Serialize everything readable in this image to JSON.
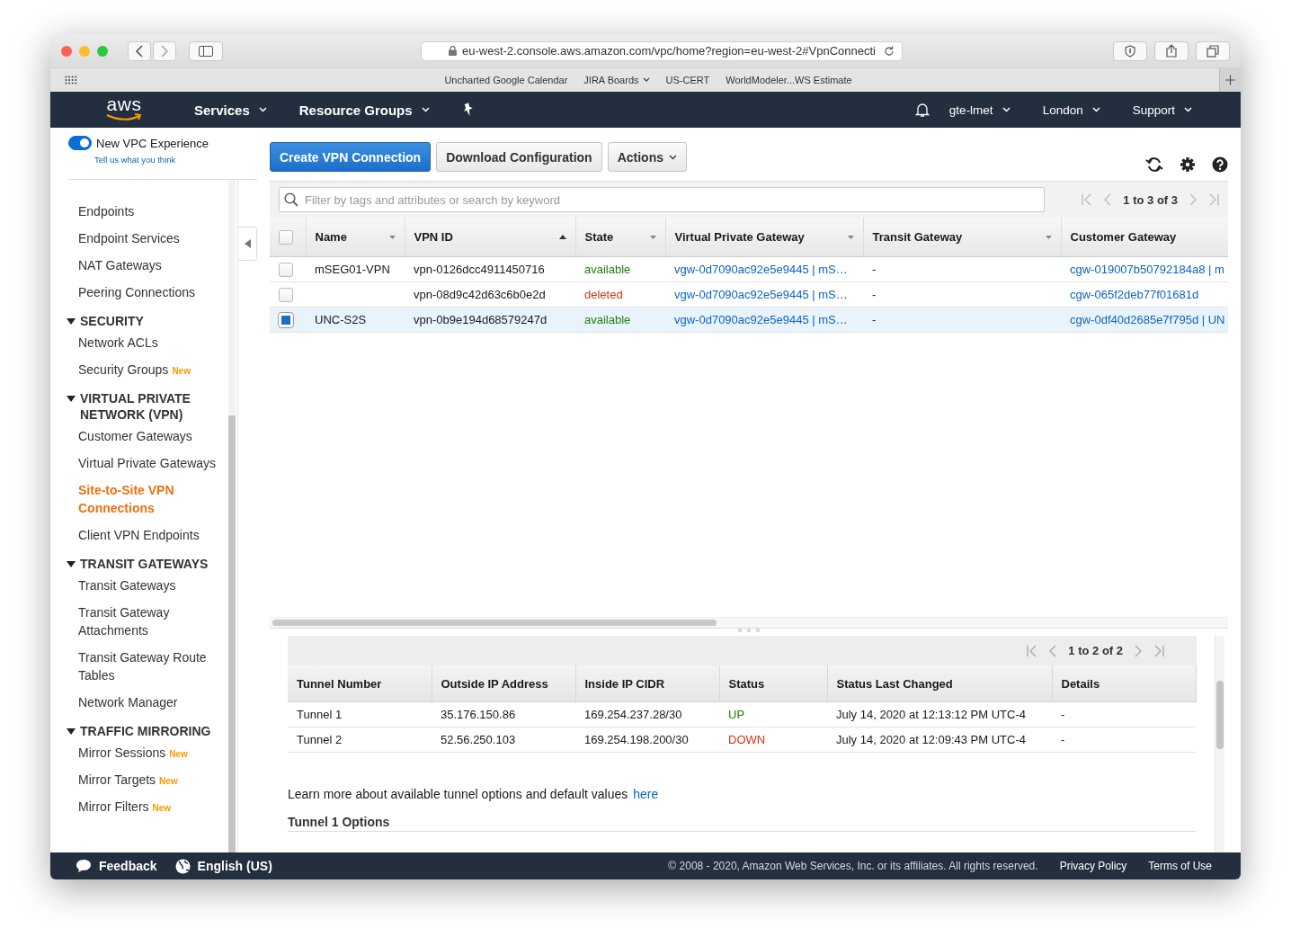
{
  "browser": {
    "url": "eu-west-2.console.aws.amazon.com/vpc/home?region=eu-west-2#VpnConnecti",
    "bookmarks": [
      {
        "label": "Uncharted Google Calendar",
        "has_menu": false
      },
      {
        "label": "JIRA Boards",
        "has_menu": true
      },
      {
        "label": "US-CERT",
        "has_menu": false
      },
      {
        "label": "WorldModeler...WS Estimate",
        "has_menu": false
      }
    ]
  },
  "nav": {
    "logo": "aws",
    "left": [
      {
        "label": "Services",
        "has_menu": true
      },
      {
        "label": "Resource Groups",
        "has_menu": true
      }
    ],
    "right": [
      {
        "label": "gte-lmet",
        "has_menu": true
      },
      {
        "label": "London",
        "has_menu": true
      },
      {
        "label": "Support",
        "has_menu": true
      }
    ]
  },
  "sidebar": {
    "toggle": {
      "label": "New VPC Experience",
      "on": true
    },
    "feedback_link": "Tell us what you think",
    "sections": [
      {
        "items": [
          {
            "label": "Endpoints",
            "selected": false
          },
          {
            "label": "Endpoint Services",
            "selected": false
          },
          {
            "label": "NAT Gateways",
            "selected": false
          },
          {
            "label": "Peering Connections",
            "selected": false
          }
        ]
      },
      {
        "heading": "SECURITY",
        "expanded": true,
        "items": [
          {
            "label": "Network ACLs",
            "selected": false
          },
          {
            "label": "Security Groups",
            "selected": false,
            "badge": "New"
          }
        ]
      },
      {
        "heading": "VIRTUAL PRIVATE NETWORK (VPN)",
        "expanded": true,
        "items": [
          {
            "label": "Customer Gateways",
            "selected": false
          },
          {
            "label": "Virtual Private Gateways",
            "selected": false
          },
          {
            "label": "Site-to-Site VPN Connections",
            "selected": true
          },
          {
            "label": "Client VPN Endpoints",
            "selected": false
          }
        ]
      },
      {
        "heading": "TRANSIT GATEWAYS",
        "expanded": true,
        "items": [
          {
            "label": "Transit Gateways",
            "selected": false
          },
          {
            "label": "Transit Gateway Attachments",
            "selected": false
          },
          {
            "label": "Transit Gateway Route Tables",
            "selected": false
          },
          {
            "label": "Network Manager",
            "selected": false
          }
        ]
      },
      {
        "heading": "TRAFFIC MIRRORING",
        "expanded": true,
        "items": [
          {
            "label": "Mirror Sessions",
            "selected": false,
            "badge": "New"
          },
          {
            "label": "Mirror Targets",
            "selected": false,
            "badge": "New"
          },
          {
            "label": "Mirror Filters",
            "selected": false,
            "badge": "New"
          }
        ]
      }
    ]
  },
  "toolbar": {
    "buttons": [
      {
        "label": "Create VPN Connection",
        "kind": "primary"
      },
      {
        "label": "Download Configuration",
        "kind": "default"
      },
      {
        "label": "Actions",
        "kind": "menu"
      }
    ]
  },
  "filter": {
    "placeholder": "Filter by tags and attributes or search by keyword",
    "pagination": "1 to 3 of 3"
  },
  "table": {
    "all_selected": false,
    "columns": [
      {
        "label": "Name",
        "kind": "menu"
      },
      {
        "label": "VPN ID",
        "kind": "sorted"
      },
      {
        "label": "State",
        "kind": "menu"
      },
      {
        "label": "Virtual Private Gateway",
        "kind": "menu"
      },
      {
        "label": "Transit Gateway",
        "kind": "menu"
      },
      {
        "label": "Customer Gateway",
        "kind": "plain"
      }
    ],
    "rows": [
      {
        "selected": false,
        "name": "mSEG01-VPN",
        "vpn_id": "vpn-0126dcc4911450716",
        "state": {
          "text": "available",
          "color": "#1d8102"
        },
        "vgw": "vgw-0d7090ac92e5e9445 | mS…",
        "tgw": "-",
        "cgw": "cgw-019007b50792184a8 | m"
      },
      {
        "selected": false,
        "name": "",
        "vpn_id": "vpn-08d9c42d63c6b0e2d",
        "state": {
          "text": "deleted",
          "color": "#d13212"
        },
        "vgw": "vgw-0d7090ac92e5e9445 | mS…",
        "tgw": "-",
        "cgw": "cgw-065f2deb77f01681d"
      },
      {
        "selected": true,
        "name": "UNC-S2S",
        "vpn_id": "vpn-0b9e194d68579247d",
        "state": {
          "text": "available",
          "color": "#1d8102"
        },
        "vgw": "vgw-0d7090ac92e5e9445 | mS…",
        "tgw": "-",
        "cgw": "cgw-0df40d2685e7f795d | UN"
      }
    ]
  },
  "tunnels": {
    "pagination": "1 to 2 of 2",
    "columns": [
      "Tunnel Number",
      "Outside IP Address",
      "Inside IP CIDR",
      "Status",
      "Status Last Changed",
      "Details"
    ],
    "rows": [
      {
        "tunnel": "Tunnel 1",
        "outside_ip": "35.176.150.86",
        "inside_cidr": "169.254.237.28/30",
        "status": {
          "text": "UP",
          "color": "#1d8102"
        },
        "changed": "July 14, 2020 at 12:13:12 PM UTC-4",
        "details": "-"
      },
      {
        "tunnel": "Tunnel 2",
        "outside_ip": "52.56.250.103",
        "inside_cidr": "169.254.198.200/30",
        "status": {
          "text": "DOWN",
          "color": "#d13212"
        },
        "changed": "July 14, 2020 at 12:09:43 PM UTC-4",
        "details": "-"
      }
    ],
    "learn_more": {
      "text": "Learn more about available tunnel options and default values",
      "link": "here"
    },
    "section_title": "Tunnel 1 Options"
  },
  "footer": {
    "feedback": "Feedback",
    "language": "English (US)",
    "copyright": "© 2008 - 2020, Amazon Web Services, Inc. or its affiliates. All rights reserved.",
    "links": [
      "Privacy Policy",
      "Terms of Use"
    ]
  }
}
